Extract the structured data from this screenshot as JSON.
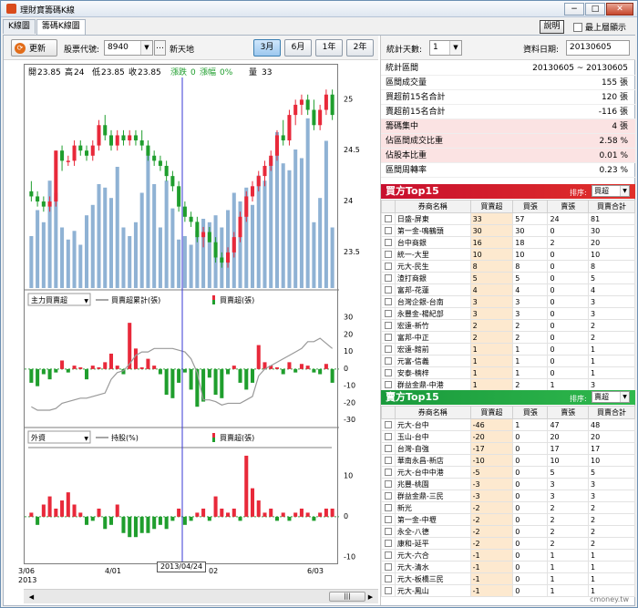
{
  "window": {
    "title": "理財寶籌碼K線",
    "help_label": "說明",
    "topmost_label": "最上層顯示",
    "watermark": "cmoney.tw"
  },
  "tabs": [
    {
      "label": "K線圖",
      "active": false
    },
    {
      "label": "籌碼K線圖",
      "active": true
    }
  ],
  "toolbar": {
    "refresh_label": "更新",
    "stock_label": "股票代號:",
    "stock_code": "8940",
    "stock_name": "新天地",
    "periods": [
      {
        "label": "3月",
        "active": true
      },
      {
        "label": "6月",
        "active": false
      },
      {
        "label": "1年",
        "active": false
      },
      {
        "label": "2年",
        "active": false
      }
    ]
  },
  "chart_info": {
    "open_label": "開",
    "open": "23.85",
    "high_label": "高",
    "high": "24",
    "low_label": "低",
    "low": "23.85",
    "close_label": "收",
    "close": "23.85",
    "change_label": "漲跌",
    "change": "0",
    "pct_label": "漲幅",
    "pct": "0%",
    "vol_label": "量",
    "vol": "33"
  },
  "chart_data": [
    {
      "type": "candlestick",
      "title": "",
      "y_ticks": [
        "25",
        "24.5",
        "24",
        "23.5"
      ],
      "ylim": [
        23.15,
        25.2
      ],
      "volume_visible": true,
      "candles": [
        {
          "o": 24.1,
          "h": 24.2,
          "l": 24.0,
          "c": 24.05,
          "v": 0.3
        },
        {
          "o": 24.05,
          "h": 24.1,
          "l": 23.95,
          "c": 24.0,
          "v": 0.45
        },
        {
          "o": 24.0,
          "h": 24.05,
          "l": 23.9,
          "c": 23.95,
          "v": 0.38
        },
        {
          "o": 23.95,
          "h": 24.05,
          "l": 23.9,
          "c": 24.0,
          "v": 0.62
        },
        {
          "o": 24.0,
          "h": 24.5,
          "l": 23.95,
          "c": 24.5,
          "v": 0.55
        },
        {
          "o": 24.5,
          "h": 24.55,
          "l": 24.3,
          "c": 24.4,
          "v": 0.35
        },
        {
          "o": 24.4,
          "h": 24.45,
          "l": 24.35,
          "c": 24.4,
          "v": 0.28
        },
        {
          "o": 24.4,
          "h": 24.6,
          "l": 24.35,
          "c": 24.55,
          "v": 0.33
        },
        {
          "o": 24.55,
          "h": 24.6,
          "l": 24.45,
          "c": 24.5,
          "v": 0.25
        },
        {
          "o": 24.5,
          "h": 24.55,
          "l": 24.4,
          "c": 24.45,
          "v": 0.42
        },
        {
          "o": 24.45,
          "h": 24.6,
          "l": 24.4,
          "c": 24.55,
          "v": 0.48
        },
        {
          "o": 24.55,
          "h": 24.8,
          "l": 24.5,
          "c": 24.75,
          "v": 0.6
        },
        {
          "o": 24.75,
          "h": 24.85,
          "l": 24.6,
          "c": 24.65,
          "v": 0.58
        },
        {
          "o": 24.65,
          "h": 24.7,
          "l": 24.5,
          "c": 24.55,
          "v": 0.52
        },
        {
          "o": 24.55,
          "h": 24.7,
          "l": 24.5,
          "c": 24.65,
          "v": 0.7
        },
        {
          "o": 24.65,
          "h": 24.7,
          "l": 24.55,
          "c": 24.6,
          "v": 0.35
        },
        {
          "o": 24.6,
          "h": 24.7,
          "l": 24.55,
          "c": 24.65,
          "v": 0.3
        },
        {
          "o": 24.65,
          "h": 24.7,
          "l": 24.55,
          "c": 24.6,
          "v": 0.38
        },
        {
          "o": 24.6,
          "h": 24.7,
          "l": 24.5,
          "c": 24.55,
          "v": 0.55
        },
        {
          "o": 24.55,
          "h": 24.6,
          "l": 24.4,
          "c": 24.45,
          "v": 0.82
        },
        {
          "o": 24.45,
          "h": 24.5,
          "l": 24.35,
          "c": 24.4,
          "v": 0.6
        },
        {
          "o": 24.4,
          "h": 24.45,
          "l": 24.3,
          "c": 24.35,
          "v": 0.35
        },
        {
          "o": 24.35,
          "h": 24.4,
          "l": 24.2,
          "c": 24.25,
          "v": 0.62
        },
        {
          "o": 24.25,
          "h": 24.3,
          "l": 24.1,
          "c": 24.15,
          "v": 0.46
        },
        {
          "o": 24.15,
          "h": 24.2,
          "l": 23.9,
          "c": 23.95,
          "v": 0.28
        },
        {
          "o": 23.95,
          "h": 24.0,
          "l": 23.8,
          "c": 23.85,
          "v": 0.3
        },
        {
          "o": 23.85,
          "h": 23.9,
          "l": 23.75,
          "c": 23.8,
          "v": 0.25
        },
        {
          "o": 23.8,
          "h": 23.85,
          "l": 23.6,
          "c": 23.65,
          "v": 0.33
        },
        {
          "o": 23.65,
          "h": 23.75,
          "l": 23.55,
          "c": 23.7,
          "v": 0.4
        },
        {
          "o": 23.7,
          "h": 23.75,
          "l": 23.6,
          "c": 23.6,
          "v": 0.38
        },
        {
          "o": 23.6,
          "h": 23.65,
          "l": 23.4,
          "c": 23.45,
          "v": 0.42
        },
        {
          "o": 23.45,
          "h": 23.5,
          "l": 23.35,
          "c": 23.4,
          "v": 0.35
        },
        {
          "o": 23.4,
          "h": 23.55,
          "l": 23.35,
          "c": 23.5,
          "v": 0.45
        },
        {
          "o": 23.5,
          "h": 23.7,
          "l": 23.45,
          "c": 23.65,
          "v": 0.55
        },
        {
          "o": 23.65,
          "h": 23.9,
          "l": 23.6,
          "c": 23.85,
          "v": 0.5
        },
        {
          "o": 23.85,
          "h": 24.1,
          "l": 23.8,
          "c": 24.05,
          "v": 0.58
        },
        {
          "o": 24.05,
          "h": 24.2,
          "l": 24.0,
          "c": 24.15,
          "v": 0.48
        },
        {
          "o": 24.15,
          "h": 24.3,
          "l": 24.1,
          "c": 24.25,
          "v": 0.65
        },
        {
          "o": 24.25,
          "h": 24.4,
          "l": 24.15,
          "c": 24.35,
          "v": 0.62
        },
        {
          "o": 24.35,
          "h": 24.5,
          "l": 24.3,
          "c": 24.45,
          "v": 0.75
        },
        {
          "o": 24.45,
          "h": 24.7,
          "l": 24.4,
          "c": 24.65,
          "v": 0.9
        },
        {
          "o": 24.65,
          "h": 24.8,
          "l": 24.55,
          "c": 24.6,
          "v": 0.72
        },
        {
          "o": 24.6,
          "h": 24.9,
          "l": 24.55,
          "c": 24.85,
          "v": 0.68
        },
        {
          "o": 24.85,
          "h": 25.0,
          "l": 24.75,
          "c": 24.95,
          "v": 0.8
        },
        {
          "o": 24.95,
          "h": 25.05,
          "l": 24.85,
          "c": 25.0,
          "v": 0.75
        },
        {
          "o": 25.0,
          "h": 25.05,
          "l": 24.85,
          "c": 24.9,
          "v": 0.98
        },
        {
          "o": 24.9,
          "h": 25.0,
          "l": 24.7,
          "c": 24.75,
          "v": 0.38
        },
        {
          "o": 24.75,
          "h": 24.95,
          "l": 24.7,
          "c": 24.9,
          "v": 0.52
        },
        {
          "o": 24.9,
          "h": 25.1,
          "l": 24.85,
          "c": 25.05,
          "v": 0.85
        },
        {
          "o": 25.05,
          "h": 25.1,
          "l": 24.8,
          "c": 24.85,
          "v": 0.35
        }
      ]
    },
    {
      "type": "bar",
      "selector": "主力買賣超",
      "legend_line": "買賣超累計(張)",
      "legend_bar": "買賣超(張)",
      "y_ticks": [
        "30",
        "20",
        "10",
        "0",
        "-10",
        "-20",
        "-30"
      ],
      "ylim": [
        -32,
        34
      ],
      "values": [
        -8,
        -10,
        -3,
        -6,
        -2,
        5,
        -2,
        2,
        1,
        -6,
        2,
        1,
        4,
        9,
        2,
        -3,
        27,
        12,
        1,
        6,
        2,
        -3,
        -15,
        -17,
        -8,
        -2,
        -12,
        -22,
        -19,
        -5,
        -15,
        -17,
        -3,
        2,
        -8,
        -12,
        -8,
        14,
        4,
        2,
        1,
        -3,
        4,
        -2,
        3,
        2,
        -2,
        -3,
        3,
        -8
      ],
      "cumulative": [
        -22,
        -24,
        -24,
        -24,
        -23,
        -20,
        -19,
        -18,
        -17,
        -17,
        -16,
        -15,
        -14,
        -6,
        -2,
        -1,
        3,
        8,
        10,
        10,
        12,
        12,
        12,
        12,
        11,
        10,
        6,
        -2,
        -18,
        -18,
        -19,
        -21,
        -20,
        -20,
        -20,
        -18,
        -16,
        -4,
        0,
        2,
        4,
        6,
        8,
        10,
        12,
        16,
        16,
        18,
        15,
        12
      ]
    },
    {
      "type": "bar",
      "selector": "外資",
      "legend_line": "持股(%)",
      "legend_bar": "買賣超(張)",
      "y_ticks": [
        "10",
        "0",
        "-10"
      ],
      "ylim": [
        -11,
        17
      ],
      "values": [
        1,
        -2,
        3,
        5,
        2,
        4,
        6,
        3,
        1,
        -2,
        -1,
        2,
        -3,
        -2,
        3,
        -4,
        -5,
        -5,
        -4,
        -4,
        -3,
        -2,
        -3,
        -1,
        2,
        -2,
        -1,
        1,
        2,
        -1,
        5,
        2,
        1,
        2,
        -1,
        15,
        7,
        4,
        1,
        2,
        -1,
        1,
        -1,
        1,
        2,
        1,
        -1,
        1,
        2,
        2
      ],
      "hold_line": 17
    }
  ],
  "x_axis": {
    "labels": [
      "3/06",
      "4/01",
      "02",
      "6/03"
    ],
    "year": "2013",
    "cursor_date": "2013/04/24"
  },
  "right_toolbar": {
    "days_label": "統計天數:",
    "days_value": "1",
    "date_label": "資料日期:",
    "date_value": "20130605"
  },
  "stats": [
    {
      "k": "統計區間",
      "v": "20130605 ~ 20130605",
      "pink": false
    },
    {
      "k": "區間成交量",
      "v": "155 張",
      "pink": false
    },
    {
      "k": "買超前15名合計",
      "v": "120 張",
      "pink": false
    },
    {
      "k": "賣超前15名合計",
      "v": "-116 張",
      "pink": false
    },
    {
      "k": "籌碼集中",
      "v": "4 張",
      "pink": true
    },
    {
      "k": "佔區間成交比重",
      "v": "2.58 %",
      "pink": true
    },
    {
      "k": "佔股本比重",
      "v": "0.01 %",
      "pink": true
    },
    {
      "k": "區間周轉率",
      "v": "0.23 %",
      "pink": false
    }
  ],
  "buy_top": {
    "title": "買方Top15",
    "sort_label": "排序:",
    "sort_value": "買超",
    "headers": [
      "券商名稱",
      "買賣超",
      "買張",
      "賣張",
      "買賣合計"
    ],
    "rows": [
      [
        "日盛-屏東",
        "33",
        "57",
        "24",
        "81"
      ],
      [
        "第一金-鳴鶴頭",
        "30",
        "30",
        "0",
        "30"
      ],
      [
        "台中商銀",
        "16",
        "18",
        "2",
        "20"
      ],
      [
        "統一-大里",
        "10",
        "10",
        "0",
        "10"
      ],
      [
        "元大-民生",
        "8",
        "8",
        "0",
        "8"
      ],
      [
        "渣打商銀",
        "5",
        "5",
        "0",
        "5"
      ],
      [
        "富邦-花蓮",
        "4",
        "4",
        "0",
        "4"
      ],
      [
        "台灣企銀-台南",
        "3",
        "3",
        "0",
        "3"
      ],
      [
        "永豐金-楊紀部",
        "3",
        "3",
        "0",
        "3"
      ],
      [
        "宏遠-新竹",
        "2",
        "2",
        "0",
        "2"
      ],
      [
        "富邦-中正",
        "2",
        "2",
        "0",
        "2"
      ],
      [
        "宏遠-館前",
        "1",
        "1",
        "0",
        "1"
      ],
      [
        "元富-信義",
        "1",
        "1",
        "0",
        "1"
      ],
      [
        "安泰-楠梓",
        "1",
        "1",
        "0",
        "1"
      ],
      [
        "群益金鼎-中港",
        "1",
        "2",
        "1",
        "3"
      ]
    ]
  },
  "sell_top": {
    "title": "賣方Top15",
    "sort_label": "排序:",
    "sort_value": "賣超",
    "headers": [
      "券商名稱",
      "買賣超",
      "買張",
      "賣張",
      "買賣合計"
    ],
    "rows": [
      [
        "元大-台中",
        "-46",
        "1",
        "47",
        "48"
      ],
      [
        "玉山-台中",
        "-20",
        "0",
        "20",
        "20"
      ],
      [
        "台灣-自強",
        "-17",
        "0",
        "17",
        "17"
      ],
      [
        "華南永昌-新店",
        "-10",
        "0",
        "10",
        "10"
      ],
      [
        "元大-台中中港",
        "-5",
        "0",
        "5",
        "5"
      ],
      [
        "兆豐-桃園",
        "-3",
        "0",
        "3",
        "3"
      ],
      [
        "群益金鼎-三民",
        "-3",
        "0",
        "3",
        "3"
      ],
      [
        "新光",
        "-2",
        "0",
        "2",
        "2"
      ],
      [
        "第一金-中壢",
        "-2",
        "0",
        "2",
        "2"
      ],
      [
        "永全-八德",
        "-2",
        "0",
        "2",
        "2"
      ],
      [
        "康和-延平",
        "-2",
        "0",
        "2",
        "2"
      ],
      [
        "元大-六合",
        "-1",
        "0",
        "1",
        "1"
      ],
      [
        "元大-清水",
        "-1",
        "0",
        "1",
        "1"
      ],
      [
        "元大-板橋三民",
        "-1",
        "0",
        "1",
        "1"
      ],
      [
        "元大-鳳山",
        "-1",
        "0",
        "1",
        "1"
      ]
    ]
  },
  "colors": {
    "up": "#e8293a",
    "down": "#1f9e2d",
    "volume": "#8fb2d4",
    "cursor": "#3a3ad4",
    "highlight": "#fde9cf"
  }
}
